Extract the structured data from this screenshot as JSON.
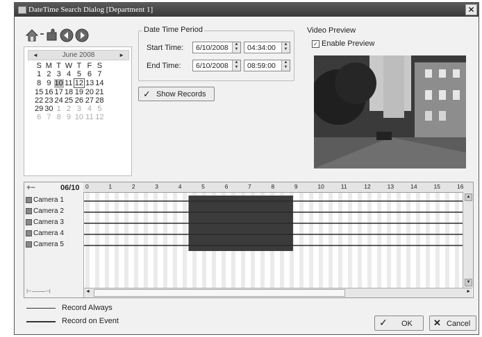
{
  "window": {
    "title": "DateTime Search Dialog  [Department 1]",
    "close_glyph": "✕"
  },
  "calendar": {
    "month_label": "June 2008",
    "prev_glyph": "◄",
    "next_glyph": "►",
    "weekdays": [
      "S",
      "M",
      "T",
      "W",
      "T",
      "F",
      "S"
    ],
    "weeks": [
      [
        {
          "d": "",
          "o": false
        },
        {
          "d": "",
          "o": false
        },
        {
          "d": "",
          "o": false
        },
        {
          "d": "",
          "o": false
        },
        {
          "d": "",
          "o": false
        },
        {
          "d": "",
          "o": false
        },
        {
          "d": "",
          "o": false
        }
      ],
      [
        {
          "d": "1"
        },
        {
          "d": "2"
        },
        {
          "d": "3"
        },
        {
          "d": "4"
        },
        {
          "d": "5"
        },
        {
          "d": "6"
        },
        {
          "d": "7"
        }
      ],
      [
        {
          "d": "8"
        },
        {
          "d": "9"
        },
        {
          "d": "10",
          "today": true
        },
        {
          "d": "11"
        },
        {
          "d": "12",
          "sel": true
        },
        {
          "d": "13"
        },
        {
          "d": "14"
        }
      ],
      [
        {
          "d": "15"
        },
        {
          "d": "16"
        },
        {
          "d": "17"
        },
        {
          "d": "18"
        },
        {
          "d": "19"
        },
        {
          "d": "20"
        },
        {
          "d": "21"
        }
      ],
      [
        {
          "d": "22"
        },
        {
          "d": "23"
        },
        {
          "d": "24"
        },
        {
          "d": "25"
        },
        {
          "d": "26"
        },
        {
          "d": "27"
        },
        {
          "d": "28"
        }
      ],
      [
        {
          "d": "29"
        },
        {
          "d": "30"
        },
        {
          "d": "1",
          "o": true
        },
        {
          "d": "2",
          "o": true
        },
        {
          "d": "3",
          "o": true
        },
        {
          "d": "4",
          "o": true
        },
        {
          "d": "5",
          "o": true
        }
      ],
      [
        {
          "d": "6",
          "o": true
        },
        {
          "d": "7",
          "o": true
        },
        {
          "d": "8",
          "o": true
        },
        {
          "d": "9",
          "o": true
        },
        {
          "d": "10",
          "o": true
        },
        {
          "d": "11",
          "o": true
        },
        {
          "d": "12",
          "o": true
        }
      ]
    ]
  },
  "period": {
    "legend": "Date Time Period",
    "start_label": "Start Time:",
    "start_date": "6/10/2008",
    "start_time": "04:34:00",
    "end_label": "End Time:",
    "end_date": "6/10/2008",
    "end_time": "08:59:00",
    "spin_up": "▲",
    "spin_down": "▼"
  },
  "show_records": {
    "label": "Show Records",
    "check_glyph": "✓"
  },
  "preview": {
    "legend": "Video Preview",
    "enable_label": "Enable Preview",
    "enabled": true
  },
  "timeline": {
    "date_label": "06/10",
    "hours": [
      "0",
      "1",
      "2",
      "3",
      "4",
      "5",
      "6",
      "7",
      "8",
      "9",
      "10",
      "11",
      "12",
      "13",
      "14",
      "15",
      "16"
    ],
    "cameras": [
      "Camera 1",
      "Camera 2",
      "Camera 3",
      "Camera 4",
      "Camera 5"
    ],
    "selected_range_hours": [
      4.5,
      9
    ],
    "visible_hours": 16.3
  },
  "legend": {
    "always_label": "Record Always",
    "event_label": "Record on Event"
  },
  "buttons": {
    "ok_label": "OK",
    "ok_glyph": "✓",
    "cancel_label": "Cancel",
    "cancel_glyph": "✕"
  },
  "colors": {
    "selection": "#3b3b3b",
    "record_line": "#2a2a2a"
  }
}
